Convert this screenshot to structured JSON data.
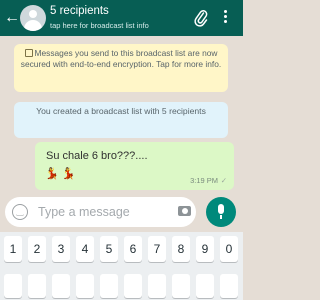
{
  "header": {
    "back_icon": "arrow-left-icon",
    "avatar_icon": "group-avatar-icon",
    "title": "5 recipients",
    "subtitle": "tap here for broadcast list info",
    "attach_icon": "paperclip-icon",
    "menu_icon": "more-vertical-icon"
  },
  "conversation": {
    "encryption_notice": "Messages you send to this broadcast list are now secured with end-to-end encryption. Tap for more info.",
    "created_notice": "You created a broadcast list with 5 recipients",
    "message": {
      "text": "Su chale 6 bro???....",
      "emoji": "💃 💃",
      "time": "3:19 PM",
      "status": "✓"
    }
  },
  "composer": {
    "placeholder": "Type a message",
    "emoji_icon": "smiley-icon",
    "camera_icon": "camera-icon",
    "mic_icon": "microphone-icon"
  },
  "keyboard": {
    "number_row": [
      "1",
      "2",
      "3",
      "4",
      "5",
      "6",
      "7",
      "8",
      "9",
      "0"
    ]
  },
  "colors": {
    "header": "#075e54",
    "chat_bg": "#e5ddd5",
    "sent_bubble": "#dcf8c6",
    "notice_yellow": "#fff6c8",
    "notice_blue": "#e1f3fb",
    "mic_button": "#00897b"
  }
}
